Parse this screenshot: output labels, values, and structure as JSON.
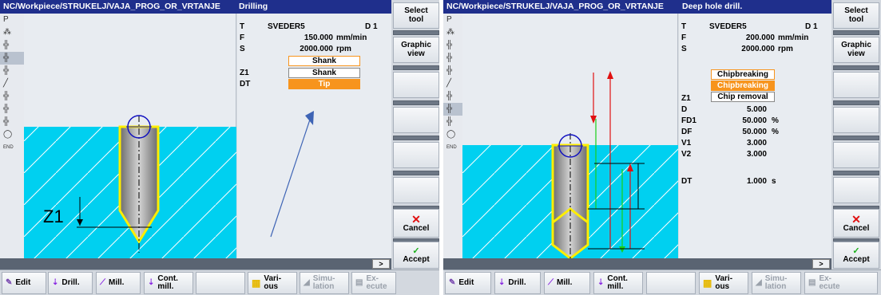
{
  "left": {
    "title": "NC/Workpiece/STRUKELJ/VAJA_PROG_OR_VRTANJE",
    "cycle_title": "Drilling",
    "params": [
      {
        "label": "T",
        "value": "SVEDER5",
        "extra": "D 1"
      },
      {
        "label": "F",
        "value": "150.000",
        "unit": "mm/min"
      },
      {
        "label": "S",
        "value": "2000.000",
        "unit": "rpm"
      }
    ],
    "z1_label": "Z1",
    "dt_label": "DT",
    "dropdown_current": "Shank",
    "dropdown_options": [
      "Shank",
      "Tip"
    ],
    "drawing_label": "Z1",
    "softkeys": {
      "select_tool": "Select\ntool",
      "graphic_view": "Graphic\nview",
      "cancel": "Cancel",
      "accept": "Accept"
    },
    "more": ">"
  },
  "right": {
    "title": "NC/Workpiece/STRUKELJ/VAJA_PROG_OR_VRTANJE",
    "cycle_title": "Deep hole drill.",
    "params": [
      {
        "label": "T",
        "value": "SVEDER5",
        "extra": "D 1"
      },
      {
        "label": "F",
        "value": "200.000",
        "unit": "mm/min"
      },
      {
        "label": "S",
        "value": "2000.000",
        "unit": "rpm"
      }
    ],
    "dropdown_current": "Chipbreaking",
    "dropdown_options": [
      "Chipbreaking",
      "Chip removal"
    ],
    "params2": [
      {
        "label": "Z1",
        "value": "",
        "unit": ""
      },
      {
        "label": "D",
        "value": "5.000",
        "unit": ""
      },
      {
        "label": "FD1",
        "value": "50.000",
        "unit": "%"
      },
      {
        "label": "DF",
        "value": "50.000",
        "unit": "%"
      },
      {
        "label": "V1",
        "value": "3.000",
        "unit": ""
      },
      {
        "label": "V2",
        "value": "3.000",
        "unit": ""
      }
    ],
    "dt": {
      "label": "DT",
      "value": "1.000",
      "unit": "s"
    },
    "softkeys": {
      "select_tool": "Select\ntool",
      "graphic_view": "Graphic\nview",
      "cancel": "Cancel",
      "accept": "Accept"
    },
    "more": ">"
  },
  "hkeys": {
    "edit": "Edit",
    "drill": "Drill.",
    "mill": "Mill.",
    "cont_mill": "Cont.\nmill.",
    "various": "Vari-\nous",
    "simulation": "Simu-\nlation",
    "execute": "Ex-\necute"
  },
  "left_icons": [
    "P",
    "⁂",
    "╬",
    "╬",
    "╬",
    "╱",
    "╬",
    "╬",
    "╬",
    "◯",
    "END"
  ],
  "colors": {
    "title_bg": "#1f2f8c",
    "workpiece": "#00d0f0",
    "highlight": "#f7941d",
    "tool_outline": "#ffee00"
  }
}
